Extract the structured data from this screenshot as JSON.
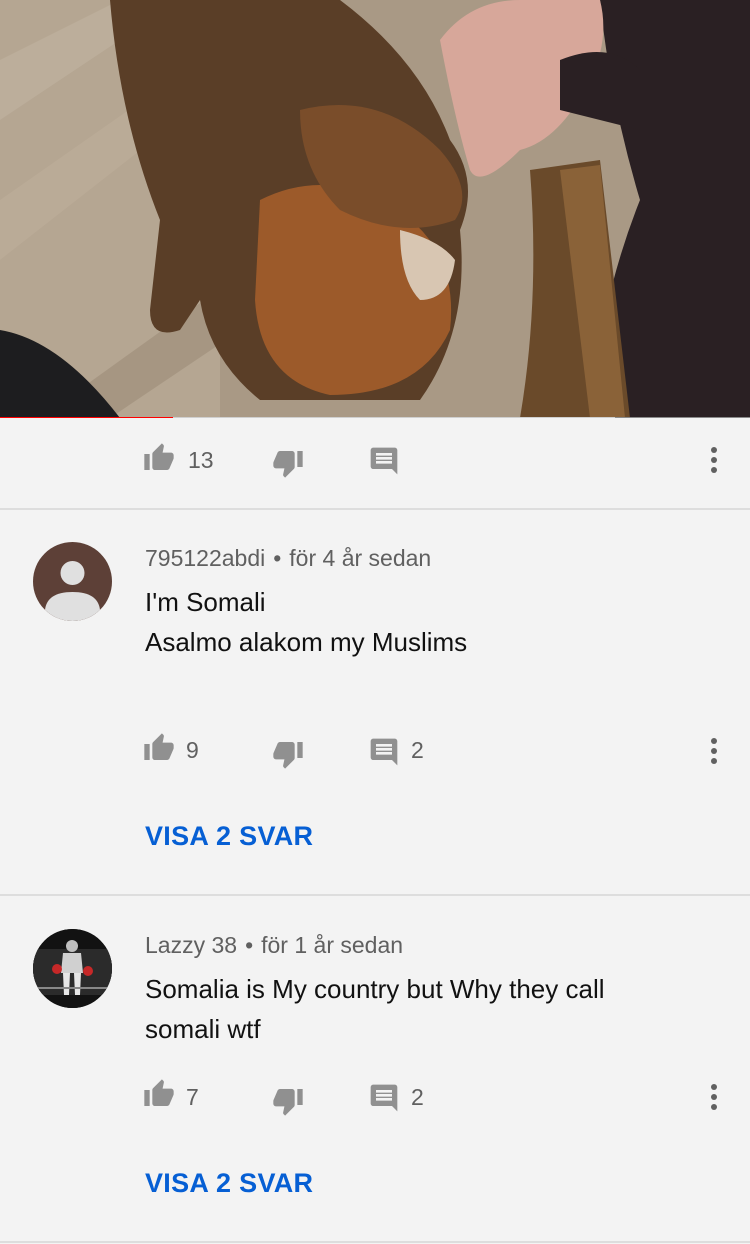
{
  "video": {
    "progress_played": 0.23,
    "progress_buffered": 0.82,
    "colors": {
      "played": "#ff0000",
      "buffered": "#cfcfcf",
      "track": "#8a8a8a"
    }
  },
  "video_actions": {
    "like_count": "13",
    "icons": [
      "thumb-up-icon",
      "thumb-down-icon",
      "comment-icon",
      "more-vertical-icon"
    ]
  },
  "comments": [
    {
      "author": "795122abdi",
      "separator": "•",
      "time": "för 4 år sedan",
      "lines": [
        "I'm Somali",
        "Asalmo alakom my Muslims"
      ],
      "like_count": "9",
      "reply_count": "2",
      "show_replies_label": "VISA 2 SVAR",
      "avatar": "default-user-avatar"
    },
    {
      "author": "Lazzy 38",
      "separator": "•",
      "time": "för 1 år sedan",
      "lines": [
        "Somalia is My country but Why they call",
        "somali wtf"
      ],
      "like_count": "7",
      "reply_count": "2",
      "show_replies_label": "VISA 2 SVAR",
      "avatar": "boxer-photo-avatar"
    }
  ],
  "colors": {
    "link": "#065fd4",
    "secondary_text": "#606060",
    "background": "#f3f3f3"
  }
}
